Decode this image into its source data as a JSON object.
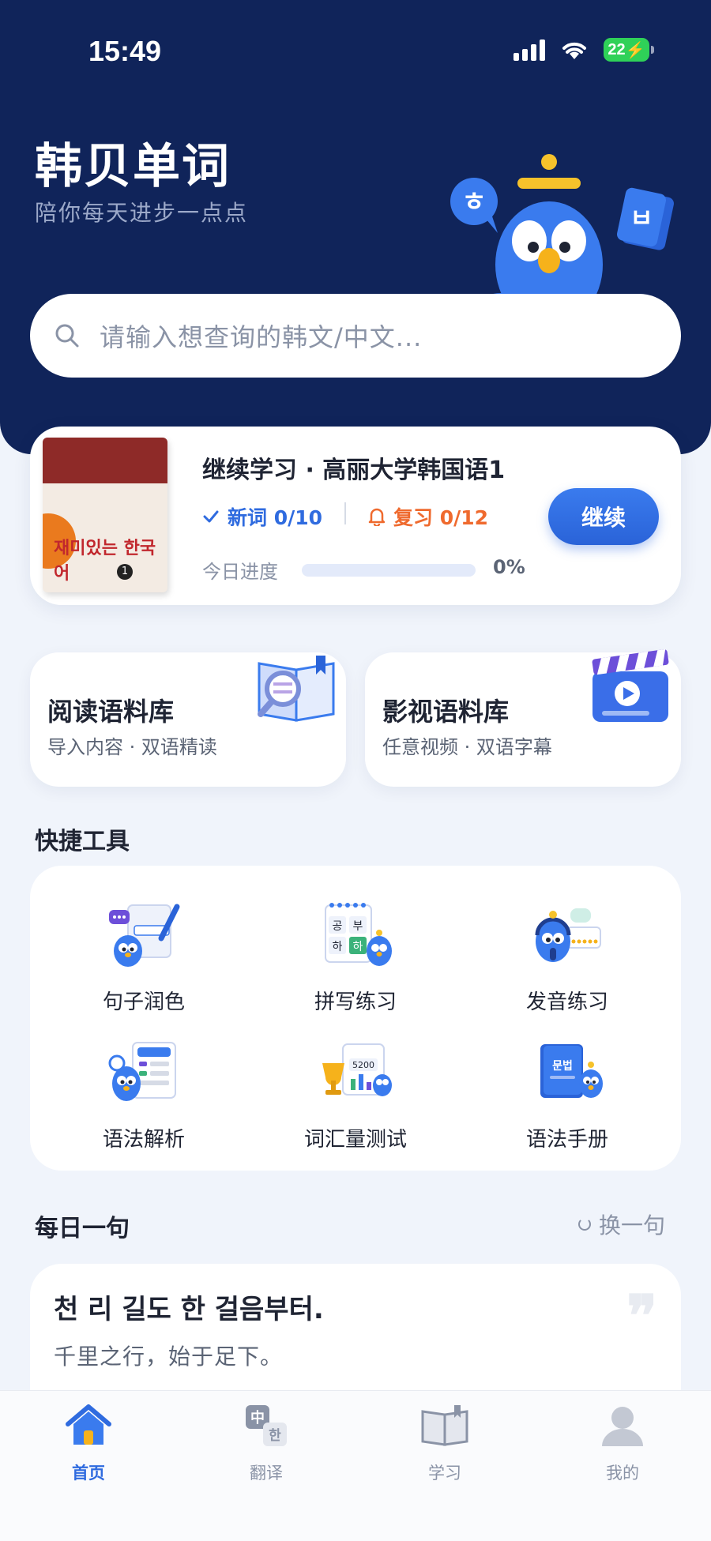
{
  "status_bar": {
    "time": "15:49",
    "battery": "22"
  },
  "header": {
    "title": "韩贝单词",
    "subtitle": "陪你每天进步一点点"
  },
  "search": {
    "placeholder": "请输入想查询的韩文/中文..."
  },
  "continue_card": {
    "title": "继续学习 · 高丽大学韩国语1",
    "new_words": "新词 0/10",
    "review": "复习 0/12",
    "progress_label": "今日进度",
    "progress_value": 0,
    "progress_text": "0%",
    "button": "继续",
    "book_title": "재미있는 한국어",
    "book_number": "1"
  },
  "corpus": [
    {
      "title": "阅读语料库",
      "subtitle": "导入内容 · 双语精读",
      "icon": "book-magnifier-icon"
    },
    {
      "title": "影视语料库",
      "subtitle": "任意视频 · 双语字幕",
      "icon": "video-clapper-icon"
    }
  ],
  "tools_section": {
    "title": "快捷工具",
    "items": [
      {
        "label": "句子润色",
        "icon": "sentence-polish-icon"
      },
      {
        "label": "拼写练习",
        "icon": "spelling-practice-icon",
        "tiles": [
          "공",
          "부",
          "하",
          "하"
        ]
      },
      {
        "label": "发音练习",
        "icon": "pronunciation-icon"
      },
      {
        "label": "语法解析",
        "icon": "grammar-analysis-icon"
      },
      {
        "label": "词汇量测试",
        "icon": "vocab-test-icon",
        "badge": "5200"
      },
      {
        "label": "语法手册",
        "icon": "grammar-book-icon",
        "book_text": "문법"
      }
    ]
  },
  "daily": {
    "title": "每日一句",
    "refresh": "换一句",
    "korean": "천 리 길도 한 걸음부터.",
    "chinese": "千里之行，始于足下。"
  },
  "tabbar": [
    {
      "label": "首页",
      "icon": "home-icon",
      "active": true
    },
    {
      "label": "翻译",
      "icon": "translate-icon",
      "active": false,
      "glyph_a": "中",
      "glyph_b": "한"
    },
    {
      "label": "学习",
      "icon": "study-book-icon",
      "active": false
    },
    {
      "label": "我的",
      "icon": "profile-icon",
      "active": false
    }
  ],
  "colors": {
    "header_bg": "#10245a",
    "accent": "#2f6bdf",
    "review": "#ef6a2e",
    "page_bg": "#f0f4fb"
  }
}
